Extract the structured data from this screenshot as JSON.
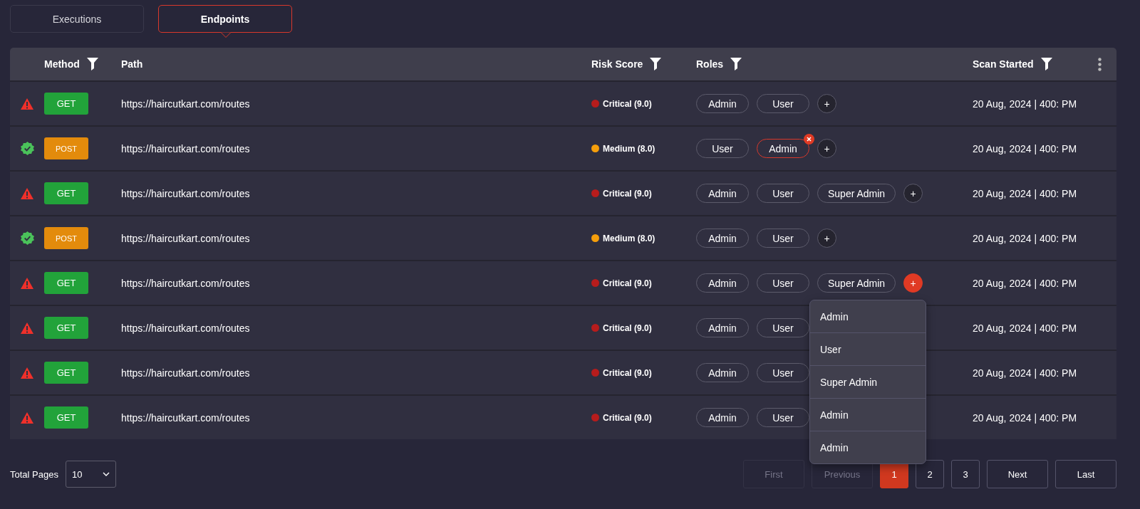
{
  "tabs": [
    {
      "label": "Executions",
      "selected": false
    },
    {
      "label": "Endpoints",
      "selected": true
    }
  ],
  "table": {
    "columns": [
      {
        "label": "Method",
        "filter": true
      },
      {
        "label": "Path",
        "filter": false
      },
      {
        "label": "Risk Score",
        "filter": true
      },
      {
        "label": "Roles",
        "filter": true
      },
      {
        "label": "Scan Started",
        "filter": true
      }
    ],
    "rows": [
      {
        "kind": "warning",
        "method": {
          "label": "GET",
          "kind": "get"
        },
        "path": "https://haircutkart.com/routes",
        "risk": {
          "label": "Critical (9.0)",
          "color": "#b71c1c"
        },
        "roles": [
          {
            "label": "Admin",
            "selected": false
          },
          {
            "label": "User",
            "selected": false
          }
        ],
        "add_button": {
          "label": "+",
          "active": false
        },
        "scan_started": "20 Aug, 2024 | 400: PM"
      },
      {
        "kind": "verified",
        "method": {
          "label": "POST",
          "kind": "post"
        },
        "path": "https://haircutkart.com/routes",
        "risk": {
          "label": "Medium (8.0)",
          "color": "#f59e0b"
        },
        "roles": [
          {
            "label": "User",
            "selected": false
          },
          {
            "label": "Admin",
            "selected": true
          }
        ],
        "add_button": {
          "label": "+",
          "active": false
        },
        "scan_started": "20 Aug, 2024 | 400: PM"
      },
      {
        "kind": "warning",
        "method": {
          "label": "GET",
          "kind": "get"
        },
        "path": "https://haircutkart.com/routes",
        "risk": {
          "label": "Critical (9.0)",
          "color": "#b71c1c"
        },
        "roles": [
          {
            "label": "Admin",
            "selected": false
          },
          {
            "label": "User",
            "selected": false
          },
          {
            "label": "Super Admin",
            "selected": false
          }
        ],
        "add_button": {
          "label": "+",
          "active": false
        },
        "scan_started": "20 Aug, 2024 | 400: PM"
      },
      {
        "kind": "verified",
        "method": {
          "label": "POST",
          "kind": "post"
        },
        "path": "https://haircutkart.com/routes",
        "risk": {
          "label": "Medium (8.0)",
          "color": "#f59e0b"
        },
        "roles": [
          {
            "label": "Admin",
            "selected": false
          },
          {
            "label": "User",
            "selected": false
          }
        ],
        "add_button": {
          "label": "+",
          "active": false
        },
        "scan_started": "20 Aug, 2024 | 400: PM"
      },
      {
        "kind": "warning",
        "method": {
          "label": "GET",
          "kind": "get"
        },
        "path": "https://haircutkart.com/routes",
        "risk": {
          "label": "Critical (9.0)",
          "color": "#b71c1c"
        },
        "roles": [
          {
            "label": "Admin",
            "selected": false
          },
          {
            "label": "User",
            "selected": false
          },
          {
            "label": "Super Admin",
            "selected": false
          }
        ],
        "add_button": {
          "label": "+",
          "active": true
        },
        "scan_started": "20 Aug, 2024 | 400: PM"
      },
      {
        "kind": "warning",
        "method": {
          "label": "GET",
          "kind": "get"
        },
        "path": "https://haircutkart.com/routes",
        "risk": {
          "label": "Critical (9.0)",
          "color": "#b71c1c"
        },
        "roles": [
          {
            "label": "Admin",
            "selected": false
          },
          {
            "label": "User",
            "selected": false
          }
        ],
        "scan_started": "20 Aug, 2024 | 400: PM"
      },
      {
        "kind": "warning",
        "method": {
          "label": "GET",
          "kind": "get"
        },
        "path": "https://haircutkart.com/routes",
        "risk": {
          "label": "Critical (9.0)",
          "color": "#b71c1c"
        },
        "roles": [
          {
            "label": "Admin",
            "selected": false
          },
          {
            "label": "User",
            "selected": false
          }
        ],
        "scan_started": "20 Aug, 2024 | 400: PM"
      },
      {
        "kind": "warning",
        "method": {
          "label": "GET",
          "kind": "get"
        },
        "path": "https://haircutkart.com/routes",
        "risk": {
          "label": "Critical (9.0)",
          "color": "#b71c1c"
        },
        "roles": [
          {
            "label": "Admin",
            "selected": false
          },
          {
            "label": "User",
            "selected": false
          }
        ],
        "scan_started": "20 Aug, 2024 | 400: PM"
      }
    ]
  },
  "role_menu": {
    "items": [
      "Admin",
      "User",
      "Super Admin",
      "Admin",
      "Admin"
    ]
  },
  "footer": {
    "total_pages_label": "Total Pages",
    "page_size": "10",
    "pager": [
      {
        "label": "First",
        "kind": "nav",
        "disabled": true
      },
      {
        "label": "Previous",
        "kind": "nav",
        "disabled": true
      },
      {
        "label": "1",
        "kind": "page",
        "selected": true
      },
      {
        "label": "2",
        "kind": "page",
        "selected": false
      },
      {
        "label": "3",
        "kind": "page",
        "selected": false
      },
      {
        "label": "Next",
        "kind": "nav",
        "disabled": false
      },
      {
        "label": "Last",
        "kind": "nav",
        "disabled": false
      }
    ]
  }
}
